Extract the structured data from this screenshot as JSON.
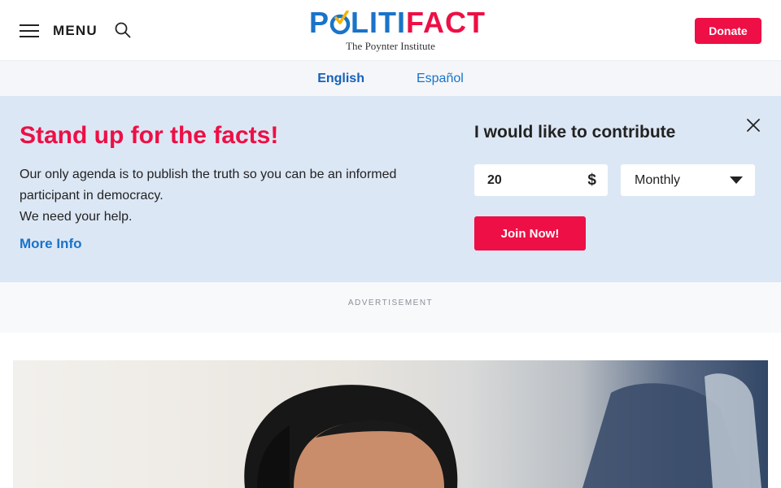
{
  "header": {
    "menu_label": "MENU",
    "logo": {
      "brand_part1": "P",
      "brand_part2": "LITI",
      "brand_part3": "FACT",
      "tagline": "The Poynter Institute"
    },
    "donate_label": "Donate"
  },
  "languages": [
    {
      "label": "English",
      "active": true
    },
    {
      "label": "Español",
      "active": false
    }
  ],
  "banner": {
    "title": "Stand up for the facts!",
    "text_line1": "Our only agenda is to publish the truth so you can be an informed participant in democracy.",
    "text_line2": "We need your help.",
    "more_info_label": "More Info",
    "contribute_title": "I would like to contribute",
    "amount_value": "20",
    "currency_symbol": "$",
    "frequency_selected": "Monthly",
    "join_label": "Join Now!"
  },
  "advertisement": {
    "label": "ADVERTISEMENT"
  },
  "colors": {
    "brand_blue": "#1a73c9",
    "brand_red": "#ed0f45",
    "banner_bg": "#dce7f5"
  },
  "icons": {
    "menu": "hamburger-icon",
    "search": "search-icon",
    "close": "close-icon",
    "dropdown": "chevron-down-icon"
  }
}
